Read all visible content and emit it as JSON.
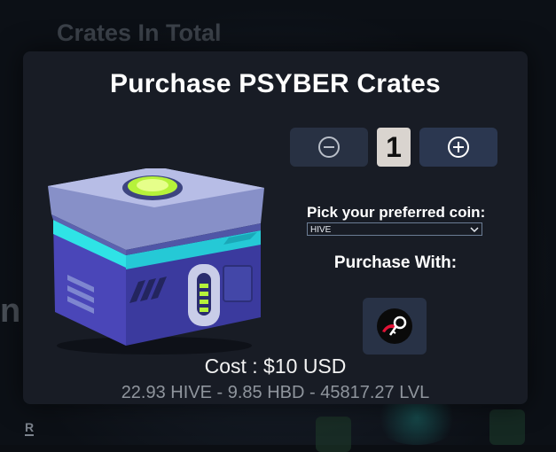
{
  "background": {
    "heading": "Crates In Total",
    "tab_label": "R"
  },
  "modal": {
    "title": "Purchase PSYBER Crates",
    "quantity": "1",
    "pick_coin_label": "Pick your preferred coin:",
    "coin_selected": "HIVE",
    "purchase_with_label": "Purchase With:",
    "cost_text": "Cost : $10 USD",
    "prices_text": "22.93 HIVE - 9.85 HBD - 45817.27 LVL"
  },
  "icons": {
    "decrease": "minus-circle-icon",
    "increase": "plus-circle-icon",
    "payment": "hive-keychain-icon",
    "dropdown": "chevron-down-icon"
  },
  "colors": {
    "modal_bg": "#181c25",
    "button_bg": "#2c3548",
    "qty_bg": "#d9d4cf",
    "crate_accent": "#b6f23a",
    "crate_teal": "#2fe3e6",
    "keychain_red": "#e31337"
  }
}
